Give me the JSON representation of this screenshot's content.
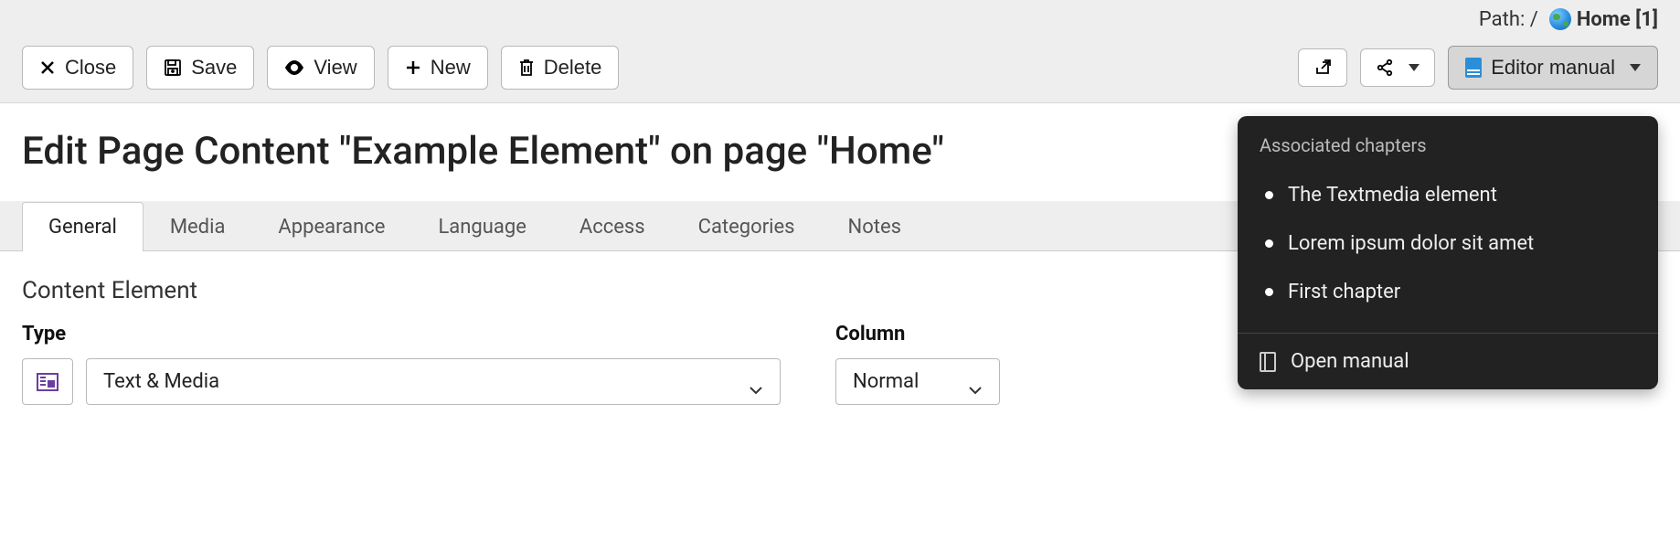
{
  "path": {
    "label": "Path: /",
    "page": "Home [1]"
  },
  "toolbar": {
    "close": "Close",
    "save": "Save",
    "view": "View",
    "new": "New",
    "delete": "Delete",
    "editor_manual": "Editor manual"
  },
  "header": "Edit Page Content \"Example Element\" on page \"Home\"",
  "tabs": [
    "General",
    "Media",
    "Appearance",
    "Language",
    "Access",
    "Categories",
    "Notes"
  ],
  "active_tab": 0,
  "section": "Content Element",
  "fields": {
    "type": {
      "label": "Type",
      "value": "Text & Media"
    },
    "column": {
      "label": "Column",
      "value": "Normal"
    }
  },
  "popover": {
    "title": "Associated chapters",
    "items": [
      "The Textmedia element",
      "Lorem ipsum dolor sit amet",
      "First chapter"
    ],
    "footer": "Open manual"
  }
}
